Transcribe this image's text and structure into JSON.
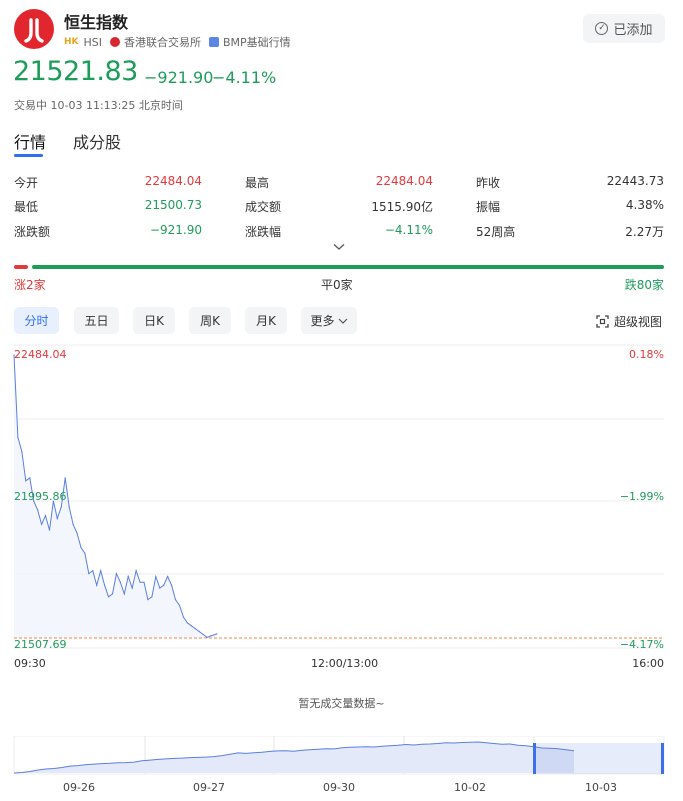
{
  "header": {
    "name": "恒生指数",
    "market_tag": "HK",
    "symbol": "HSI",
    "exchange": "香港联合交易所",
    "source": "BMP基础行情",
    "added_label": "已添加",
    "price": "21521.83",
    "change": "−921.90",
    "change_pct": "−4.11%",
    "status": "交易中 10-03 11:13:25 北京时间"
  },
  "tabs": [
    "行情",
    "成分股"
  ],
  "stats": {
    "row1": [
      {
        "label": "今开",
        "value": "22484.04"
      },
      {
        "label": "最高",
        "value": "22484.04"
      },
      {
        "label": "昨收",
        "value": "22443.73"
      }
    ],
    "row2": [
      {
        "label": "最低",
        "value": "21500.73"
      },
      {
        "label": "成交额",
        "value": "1515.90亿"
      },
      {
        "label": "振幅",
        "value": "4.38%"
      }
    ],
    "row3": [
      {
        "label": "涨跌额",
        "value": "−921.90"
      },
      {
        "label": "涨跌幅",
        "value": "−4.11%"
      },
      {
        "label": "52周高",
        "value": "2.27万"
      }
    ]
  },
  "breadth": {
    "up": "涨2家",
    "flat": "平0家",
    "down": "跌80家",
    "up_count": 2,
    "flat_count": 0,
    "down_count": 80
  },
  "period_tabs": [
    "分时",
    "五日",
    "日K",
    "周K",
    "月K",
    "更多"
  ],
  "fullscreen_label": "超级视图",
  "chart_labels": {
    "y_top": "22484.04",
    "y_mid": "21995.86",
    "y_bot": "21507.69",
    "pct_top": "0.18%",
    "pct_mid": "−1.99%",
    "pct_bot": "−4.17%",
    "x_start": "09:30",
    "x_mid": "12:00/13:00",
    "x_end": "16:00",
    "no_volume": "暂无成交量数据~"
  },
  "overview_dates": [
    "09-26",
    "09-27",
    "09-30",
    "10-02",
    "10-03"
  ],
  "colors": {
    "up": "#e4393c",
    "down": "#1e9c5a",
    "accent": "#2f6ff2",
    "line": "#5b7fe0"
  },
  "chart_data": {
    "type": "line",
    "title": "",
    "x": [
      "09:30",
      "09:32",
      "09:34",
      "09:36",
      "09:38",
      "09:40",
      "09:42",
      "09:44",
      "09:46",
      "09:48",
      "09:50",
      "09:52",
      "09:54",
      "09:56",
      "09:58",
      "10:00",
      "10:02",
      "10:04",
      "10:06",
      "10:08",
      "10:10",
      "10:12",
      "10:14",
      "10:16",
      "10:18",
      "10:20",
      "10:22",
      "10:24",
      "10:26",
      "10:28",
      "10:30",
      "10:32",
      "10:34",
      "10:36",
      "10:38",
      "10:40",
      "10:42",
      "10:44",
      "10:46",
      "10:48",
      "10:50",
      "10:52",
      "10:54",
      "10:56",
      "10:58",
      "11:00",
      "11:02",
      "11:04",
      "11:06",
      "11:08",
      "11:10",
      "11:13"
    ],
    "series": [
      {
        "values": [
          22484,
          22200,
          22150,
          22050,
          22060,
          21980,
          21950,
          21900,
          21930,
          21880,
          21980,
          21920,
          21960,
          22060,
          21960,
          21900,
          21870,
          21820,
          21800,
          21730,
          21740,
          21690,
          21740,
          21690,
          21650,
          21660,
          21730,
          21700,
          21660,
          21720,
          21680,
          21740,
          21700,
          21700,
          21640,
          21650,
          21720,
          21680,
          21690,
          21720,
          21690,
          21640,
          21620,
          21580,
          21560,
          21550,
          21540,
          21530,
          21520,
          21510,
          21515,
          21522
        ]
      }
    ],
    "ylim": [
      21507.69,
      22484.04
    ],
    "reference": {
      "prev_close": 22443.73,
      "low_line": 21507.69
    },
    "y_pct": [
      "0.18%",
      "−1.99%",
      "−4.17%"
    ],
    "xlabel": "",
    "ylabel": "",
    "grid": true
  },
  "overview_data": {
    "type": "area",
    "values": [
      22000,
      22100,
      22300,
      22600,
      22800,
      22900,
      23100,
      23400,
      23500,
      23700,
      23800,
      23900,
      23950,
      24050,
      24100,
      24200,
      24450,
      24600,
      24750,
      24850,
      24950,
      25000,
      25100,
      25150,
      25200,
      25300,
      25500,
      25800,
      26050,
      25950,
      26100,
      26200,
      26350,
      26450,
      26500,
      26400,
      26600,
      26700,
      26800,
      26900,
      26850,
      27100,
      27200,
      27250,
      27300,
      27250,
      27400,
      27500,
      27600,
      27750,
      27650,
      27800,
      27850,
      27950,
      28100,
      28050,
      28150,
      28200,
      28250,
      28100,
      27950,
      27800,
      27850,
      27600,
      27500,
      27300,
      27050,
      27000,
      26900,
      26700,
      26500
    ],
    "selection": "10-03"
  }
}
